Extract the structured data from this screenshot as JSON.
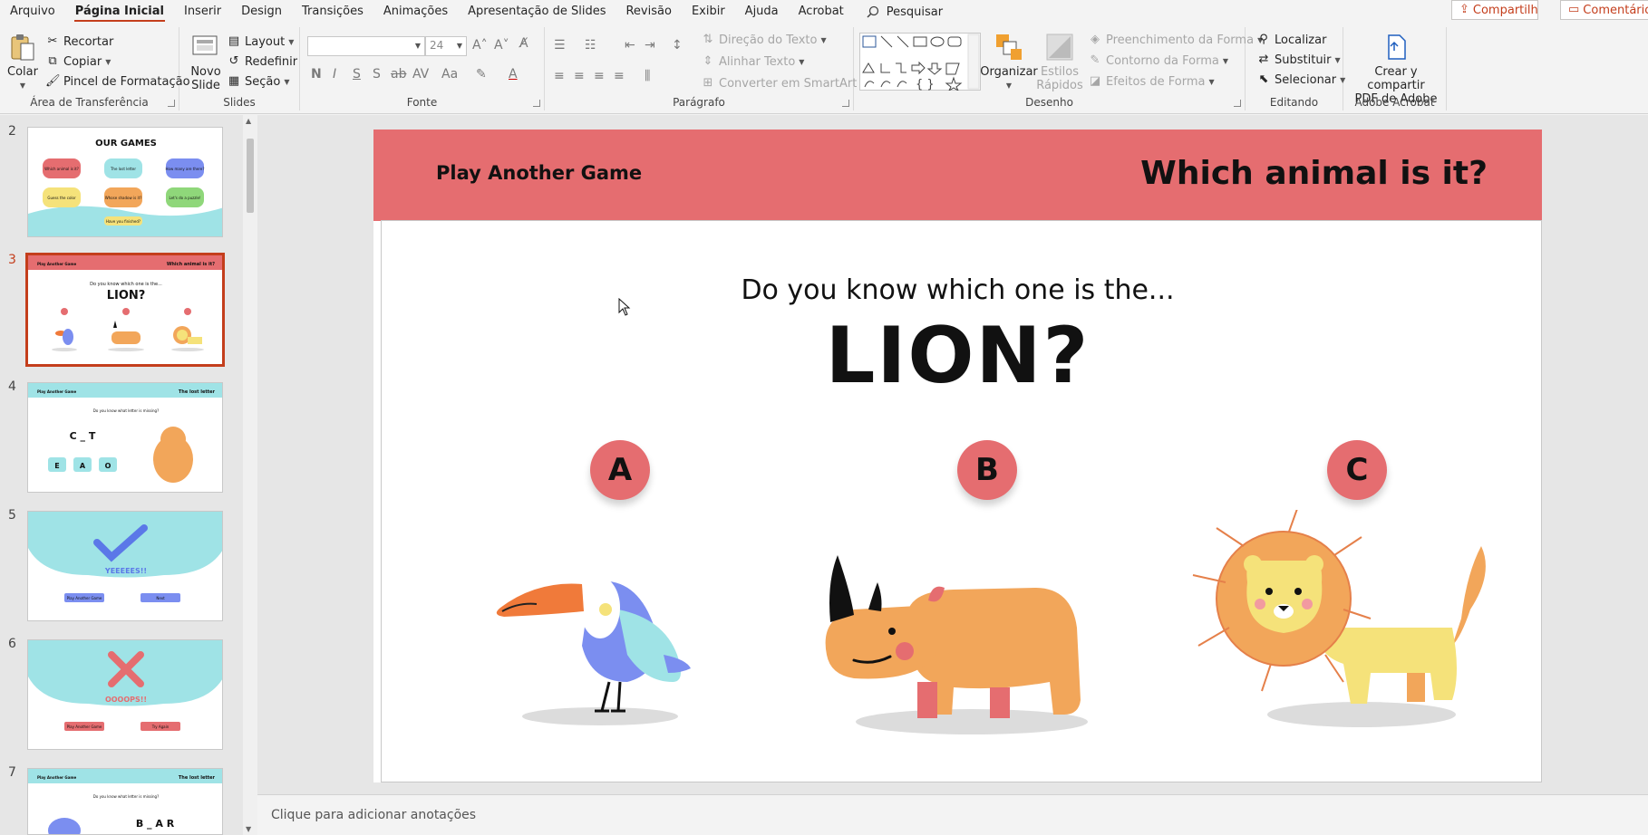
{
  "menu": {
    "items": [
      "Arquivo",
      "Página Inicial",
      "Inserir",
      "Design",
      "Transições",
      "Animações",
      "Apresentação de Slides",
      "Revisão",
      "Exibir",
      "Ajuda",
      "Acrobat"
    ],
    "search": "Pesquisar",
    "share": "Compartilhar",
    "comments": "Comentários"
  },
  "ribbon": {
    "clipboard": {
      "label": "Área de Transferência",
      "paste": "Colar",
      "cut": "Recortar",
      "copy": "Copiar",
      "format_painter": "Pincel de Formatação"
    },
    "slides": {
      "label": "Slides",
      "new_slide_1": "Novo",
      "new_slide_2": "Slide",
      "layout": "Layout",
      "reset": "Redefinir",
      "section": "Seção"
    },
    "font": {
      "label": "Fonte",
      "size": "24"
    },
    "paragraph": {
      "label": "Parágrafo",
      "text_direction": "Direção do Texto",
      "align_text": "Alinhar Texto",
      "smartart": "Converter em SmartArt"
    },
    "drawing": {
      "label": "Desenho",
      "arrange": "Organizar",
      "quick_styles_1": "Estilos",
      "quick_styles_2": "Rápidos",
      "shape_fill": "Preenchimento da Forma",
      "shape_outline": "Contorno da Forma",
      "shape_effects": "Efeitos de Forma"
    },
    "editing": {
      "label": "Editando",
      "find": "Localizar",
      "replace": "Substituir",
      "select": "Selecionar"
    },
    "acrobat": {
      "label": "Adobe Acrobat",
      "create_1": "Crear y compartir",
      "create_2": "PDF de Adobe"
    }
  },
  "thumbnails": {
    "numbers": [
      "2",
      "3",
      "4",
      "5",
      "6",
      "7"
    ],
    "slide2": {
      "title": "OUR GAMES",
      "b1": "Which animal is it?",
      "b2": "The lost letter",
      "b3": "How many are there?",
      "b4": "Guess the color",
      "b5": "Whose shadow is it?",
      "b6": "Let's do a puzzle!",
      "footer": "Have you finished?"
    },
    "slide3": {
      "left": "Play Another Game",
      "right": "Which animal is it?",
      "q": "Do you know which one is the...",
      "a": "LION?"
    },
    "slide4": {
      "left": "Play Another Game",
      "right": "The lost letter",
      "q": "Do you know what letter is missing?",
      "letters": "C  _  T",
      "opts": [
        "E",
        "A",
        "O"
      ]
    },
    "slide5": {
      "text": "YEEEEES!!",
      "b1": "Play Another Game",
      "b2": "Next"
    },
    "slide6": {
      "text": "OOOOPS!!",
      "b1": "Play Another Game",
      "b2": "Try Again"
    },
    "slide7": {
      "left": "Play Another Game",
      "right": "The lost letter",
      "q": "Do you know what letter is missing?",
      "letters": "B  _  A  R"
    }
  },
  "slide": {
    "header_left": "Play Another Game",
    "header_right": "Which animal is it?",
    "question": "Do you know which one is the...",
    "answer": "LION?",
    "options": [
      "A",
      "B",
      "C"
    ],
    "colors": {
      "band": "#e56d70",
      "accent": "#c43e1c"
    }
  },
  "notes": "Clique para adicionar anotações"
}
